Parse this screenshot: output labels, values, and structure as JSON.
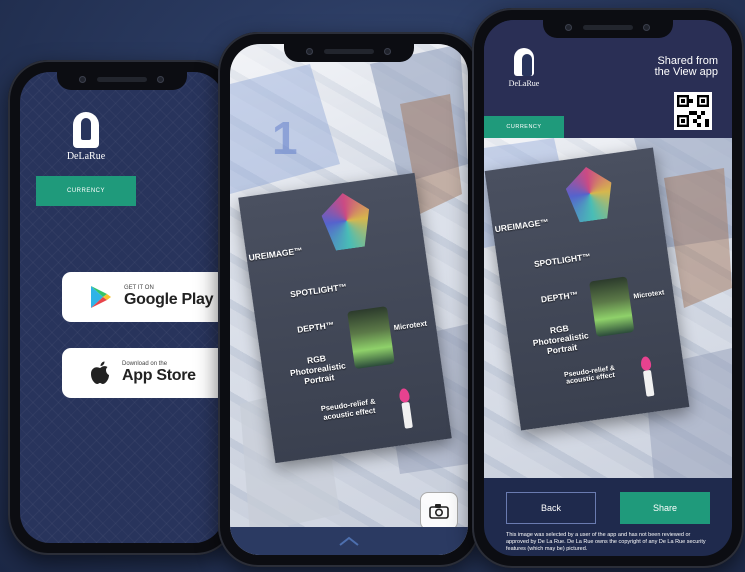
{
  "brand": {
    "logo_text": "DeLaRue"
  },
  "phone1": {
    "tab_label": "CURRENCY",
    "google_play": {
      "small": "GET IT ON",
      "big": "Google Play"
    },
    "app_store": {
      "small": "Download on the",
      "big": "App Store"
    }
  },
  "phone2": {
    "features": [
      "UREIMAGE™",
      "SPOTLIGHT™",
      "DEPTH™",
      "RGB Photorealistic Portrait",
      "Microtext",
      "Pseudo-relief & acoustic effect"
    ],
    "camera_icon": "camera-icon",
    "chevron_icon": "chevron-up-icon"
  },
  "phone3": {
    "shared_line1": "Shared from",
    "shared_line2": "the View app",
    "tab_label": "CURRENCY",
    "back_label": "Back",
    "share_label": "Share",
    "disclaimer": "This image was selected by a user of the app and has not been reviewed or approved by De La Rue. De La Rue owns the copyright of any De La Rue security features (which may be) pictured."
  },
  "colors": {
    "background": "#2a3a60",
    "accent_green": "#1f9a7b",
    "phone_body": "#0c0d12",
    "screen_navy": "#28345c"
  }
}
